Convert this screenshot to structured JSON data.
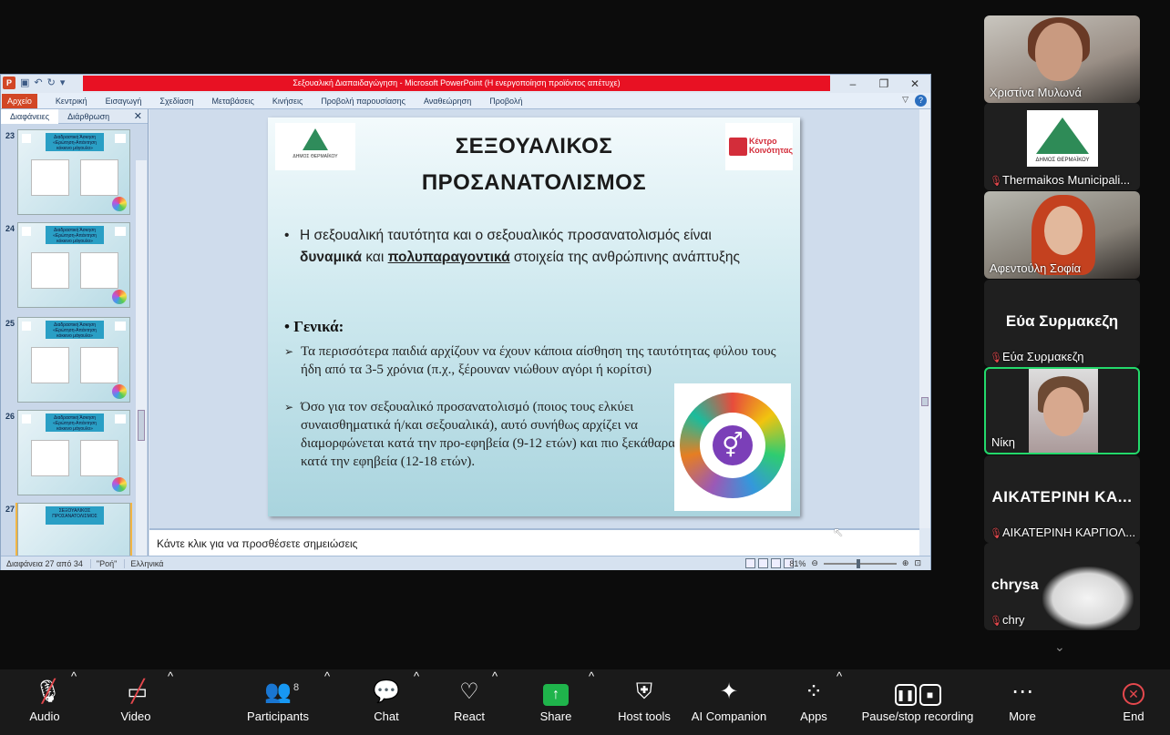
{
  "ppt": {
    "window_title": "Σεξουαλική Διαπαιδαγώγηση - Microsoft PowerPoint (Η ενεργοποίηση προϊόντος απέτυχε)",
    "file_tab": "Αρχείο",
    "tabs": [
      "Κεντρική",
      "Εισαγωγή",
      "Σχεδίαση",
      "Μεταβάσεις",
      "Κινήσεις",
      "Προβολή παρουσίασης",
      "Αναθεώρηση",
      "Προβολή"
    ],
    "pane_tabs": [
      "Διαφάνειες",
      "Διάρθρωση"
    ],
    "thumb_numbers": [
      "23",
      "24",
      "25",
      "26",
      "27"
    ],
    "thumb_title": "Διαδραστική Άσκηση «Ερώτηση-Απάντηση κόκκινο μάγουλο»",
    "thumb_last_title": "ΣΕΞΟΥΑΛΙΚΟΣ ΠΡΟΣΑΝΑΤΟΛΙΣΜΟΣ",
    "notes_placeholder": "Κάντε κλικ για να προσθέσετε σημειώσεις",
    "status_slide": "Διαφάνεια 27 από 34",
    "status_theme": "\"Ροή\"",
    "status_lang": "Ελληνικά",
    "zoom_level": "81%",
    "slide": {
      "title_line1": "ΣΕΞΟΥΑΛΙΚΟΣ",
      "title_line2": "ΠΡΟΣΑΝΑΤΟΛΙΣΜΟΣ",
      "bullet1_a": "Η σεξουαλική ταυτότητα και ο σεξουαλικός προσανατολισμός είναι ",
      "bullet1_b": "δυναμικά",
      "bullet1_c": " και ",
      "bullet1_d": "πολυπαραγοντικά",
      "bullet1_e": " στοιχεία της ανθρώπινης ανάπτυξης",
      "heading": "Γενικά:",
      "sub1": "Τα περισσότερα παιδιά αρχίζουν να έχουν κάποια αίσθηση της ταυτότητας φύλου τους ήδη από τα 3-5 χρόνια (π.χ., ξέρουναν νιώθουν αγόρι ή κορίτσι)",
      "sub2": "Όσο για τον σεξουαλικό προσανατολισμό (ποιος τους ελκύει συναισθηματικά ή/και σεξουαλικά), αυτό συνήθως αρχίζει να διαμορφώνεται κατά την προ-εφηβεία (9-12 ετών) και πιο ξεκάθαρα κατά  την εφηβεία (12-18 ετών).",
      "logo_right": "Κέντρο Κοινότητας",
      "logo_left_caption": "ΔΗΜΟΣ ΘΕΡΜΑΪΚΟΥ"
    }
  },
  "participants": [
    {
      "name": "Χριστίνα Μυλωνά",
      "muted": false,
      "video": true
    },
    {
      "name": "Thermaikos Municipali...",
      "muted": true,
      "video": false,
      "logo_caption": "ΔΗΜΟΣ ΘΕΡΜΑΪΚΟΥ"
    },
    {
      "name": "Αφεντούλη Σοφία",
      "muted": false,
      "video": true
    },
    {
      "name": "Εύα Συρμακεζη",
      "display": "Εύα Συρμακεζη",
      "muted": true,
      "video": false
    },
    {
      "name": "Νίκη",
      "muted": false,
      "video": true,
      "active_speaker": true
    },
    {
      "name": "ΑΙΚΑΤΕΡΙΝΗ ΚΑΡΓΙΟΛ...",
      "display": "ΑΙΚΑΤΕΡΙΝΗ  ΚΑ...",
      "muted": true,
      "video": false
    },
    {
      "name": "chry",
      "display": "chrysa",
      "muted": true,
      "video": false
    }
  ],
  "toolbar": {
    "audio": "Audio",
    "video": "Video",
    "participants": "Participants",
    "participants_count": "8",
    "chat": "Chat",
    "react": "React",
    "share": "Share",
    "host_tools": "Host tools",
    "ai_companion": "AI Companion",
    "apps": "Apps",
    "recording": "Pause/stop recording",
    "more": "More",
    "end": "End"
  },
  "colors": {
    "active_speaker_border": "#23d96b",
    "share_green": "#1fb44b",
    "muted_red": "#e5484d",
    "ppt_file_tab": "#d24625",
    "activation_bar": "#e81123"
  }
}
